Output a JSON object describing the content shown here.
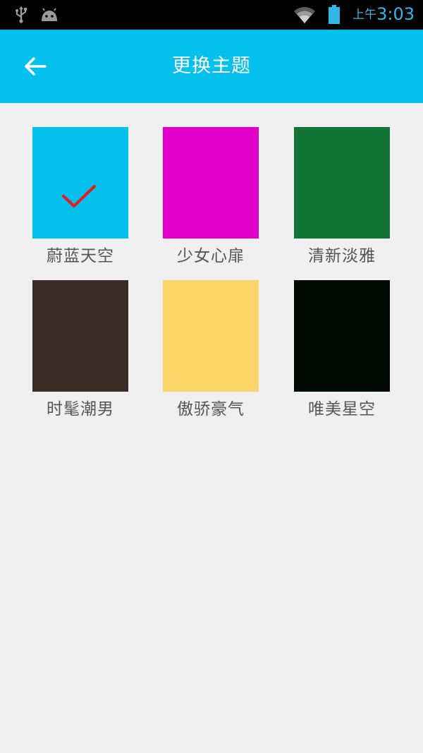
{
  "status_bar": {
    "ampm": "上午",
    "time": "3:03",
    "icons": [
      "usb-icon",
      "android-icon",
      "wifi-icon",
      "battery-icon"
    ],
    "accent_color": "#33b5e5"
  },
  "app_bar": {
    "title": "更换主题",
    "back_icon": "arrow-left-icon",
    "background": "#03c1ec"
  },
  "themes": [
    {
      "label": "蔚蓝天空",
      "color": "#03c1ec",
      "selected": true
    },
    {
      "label": "少女心扉",
      "color": "#e000c8",
      "selected": false
    },
    {
      "label": "清新淡雅",
      "color": "#127536",
      "selected": false
    },
    {
      "label": "时髦潮男",
      "color": "#3a2b27",
      "selected": false
    },
    {
      "label": "傲骄豪气",
      "color": "#fdd66a",
      "selected": false
    },
    {
      "label": "唯美星空",
      "color": "#010b02",
      "selected": false
    }
  ],
  "check_color": "#e02020"
}
